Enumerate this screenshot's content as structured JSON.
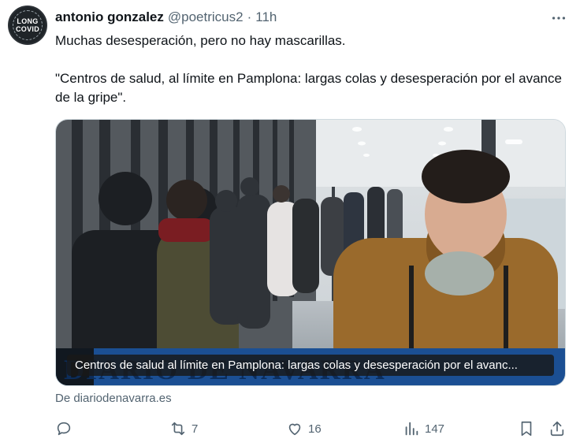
{
  "tweet": {
    "avatar_text": [
      "LONG",
      "COVID"
    ],
    "author_name": "antonio gonzalez",
    "handle": "@poetricus2",
    "separator": "·",
    "time": "11h",
    "text_line1": "Muchas desesperación, pero no hay mascarillas.",
    "text_line2": "\"Centros de salud, al límite en Pamplona: largas colas y desesperación por el avance de la gripe\"."
  },
  "card": {
    "masthead_brand": "DIARIO DE NAVARRA",
    "caption": "Centros de salud al límite en Pamplona: largas colas y desesperación por el avanc...",
    "source": "De diariodenavarra.es"
  },
  "actions": {
    "replies": "",
    "reposts": "7",
    "likes": "16",
    "views": "147"
  },
  "colors": {
    "text": "#0f1419",
    "secondary": "#536471",
    "masthead": "#1b4f93"
  },
  "icons": [
    "more-icon",
    "reply-icon",
    "repost-icon",
    "like-icon",
    "views-icon",
    "bookmark-icon",
    "share-icon"
  ]
}
